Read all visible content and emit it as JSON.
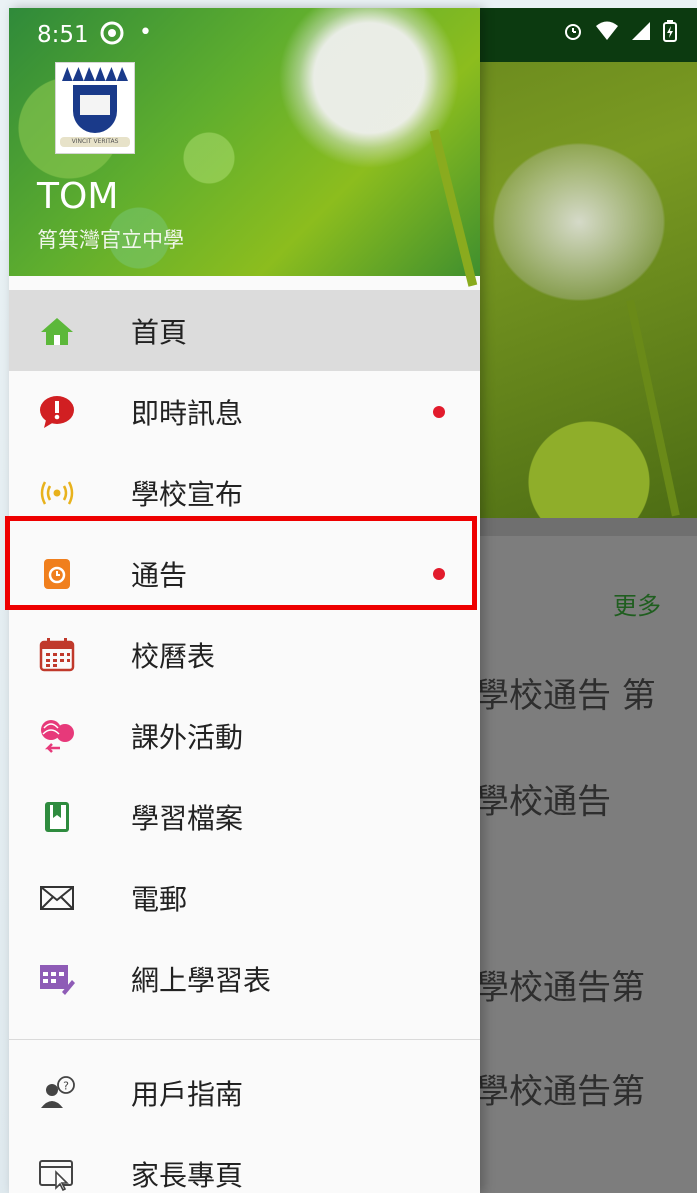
{
  "status_bar": {
    "time": "8:51",
    "dot": "•"
  },
  "drawer": {
    "user_name": "TOM",
    "school_name": "筲箕灣官立中學",
    "logo_motto": "VINCIT VERITAS",
    "menu_items": [
      {
        "label": "首頁",
        "icon": "home-icon",
        "active": true,
        "badge": false
      },
      {
        "label": "即時訊息",
        "icon": "message-alert-icon",
        "active": false,
        "badge": true
      },
      {
        "label": "學校宣布",
        "icon": "broadcast-icon",
        "active": false,
        "badge": false
      },
      {
        "label": "通告",
        "icon": "notice-icon",
        "active": false,
        "badge": true
      },
      {
        "label": "校曆表",
        "icon": "calendar-icon",
        "active": false,
        "badge": false
      },
      {
        "label": "課外活動",
        "icon": "activity-icon",
        "active": false,
        "badge": false
      },
      {
        "label": "學習檔案",
        "icon": "portfolio-icon",
        "active": false,
        "badge": false
      },
      {
        "label": "電郵",
        "icon": "mail-icon",
        "active": false,
        "badge": false
      },
      {
        "label": "網上學習表",
        "icon": "elearning-icon",
        "active": false,
        "badge": false
      }
    ],
    "secondary_items": [
      {
        "label": "用戶指南",
        "icon": "user-guide-icon"
      },
      {
        "label": "家長專頁",
        "icon": "parent-page-icon"
      }
    ]
  },
  "background": {
    "more_label": "更多",
    "notice_snippets": [
      "學校通告 第",
      "學校通告",
      "學校通告第",
      "學校通告第"
    ]
  },
  "colors": {
    "badge": "#e21b2c",
    "highlight_border": "#ee0000",
    "active_item_bg": "#dcdcdc"
  }
}
